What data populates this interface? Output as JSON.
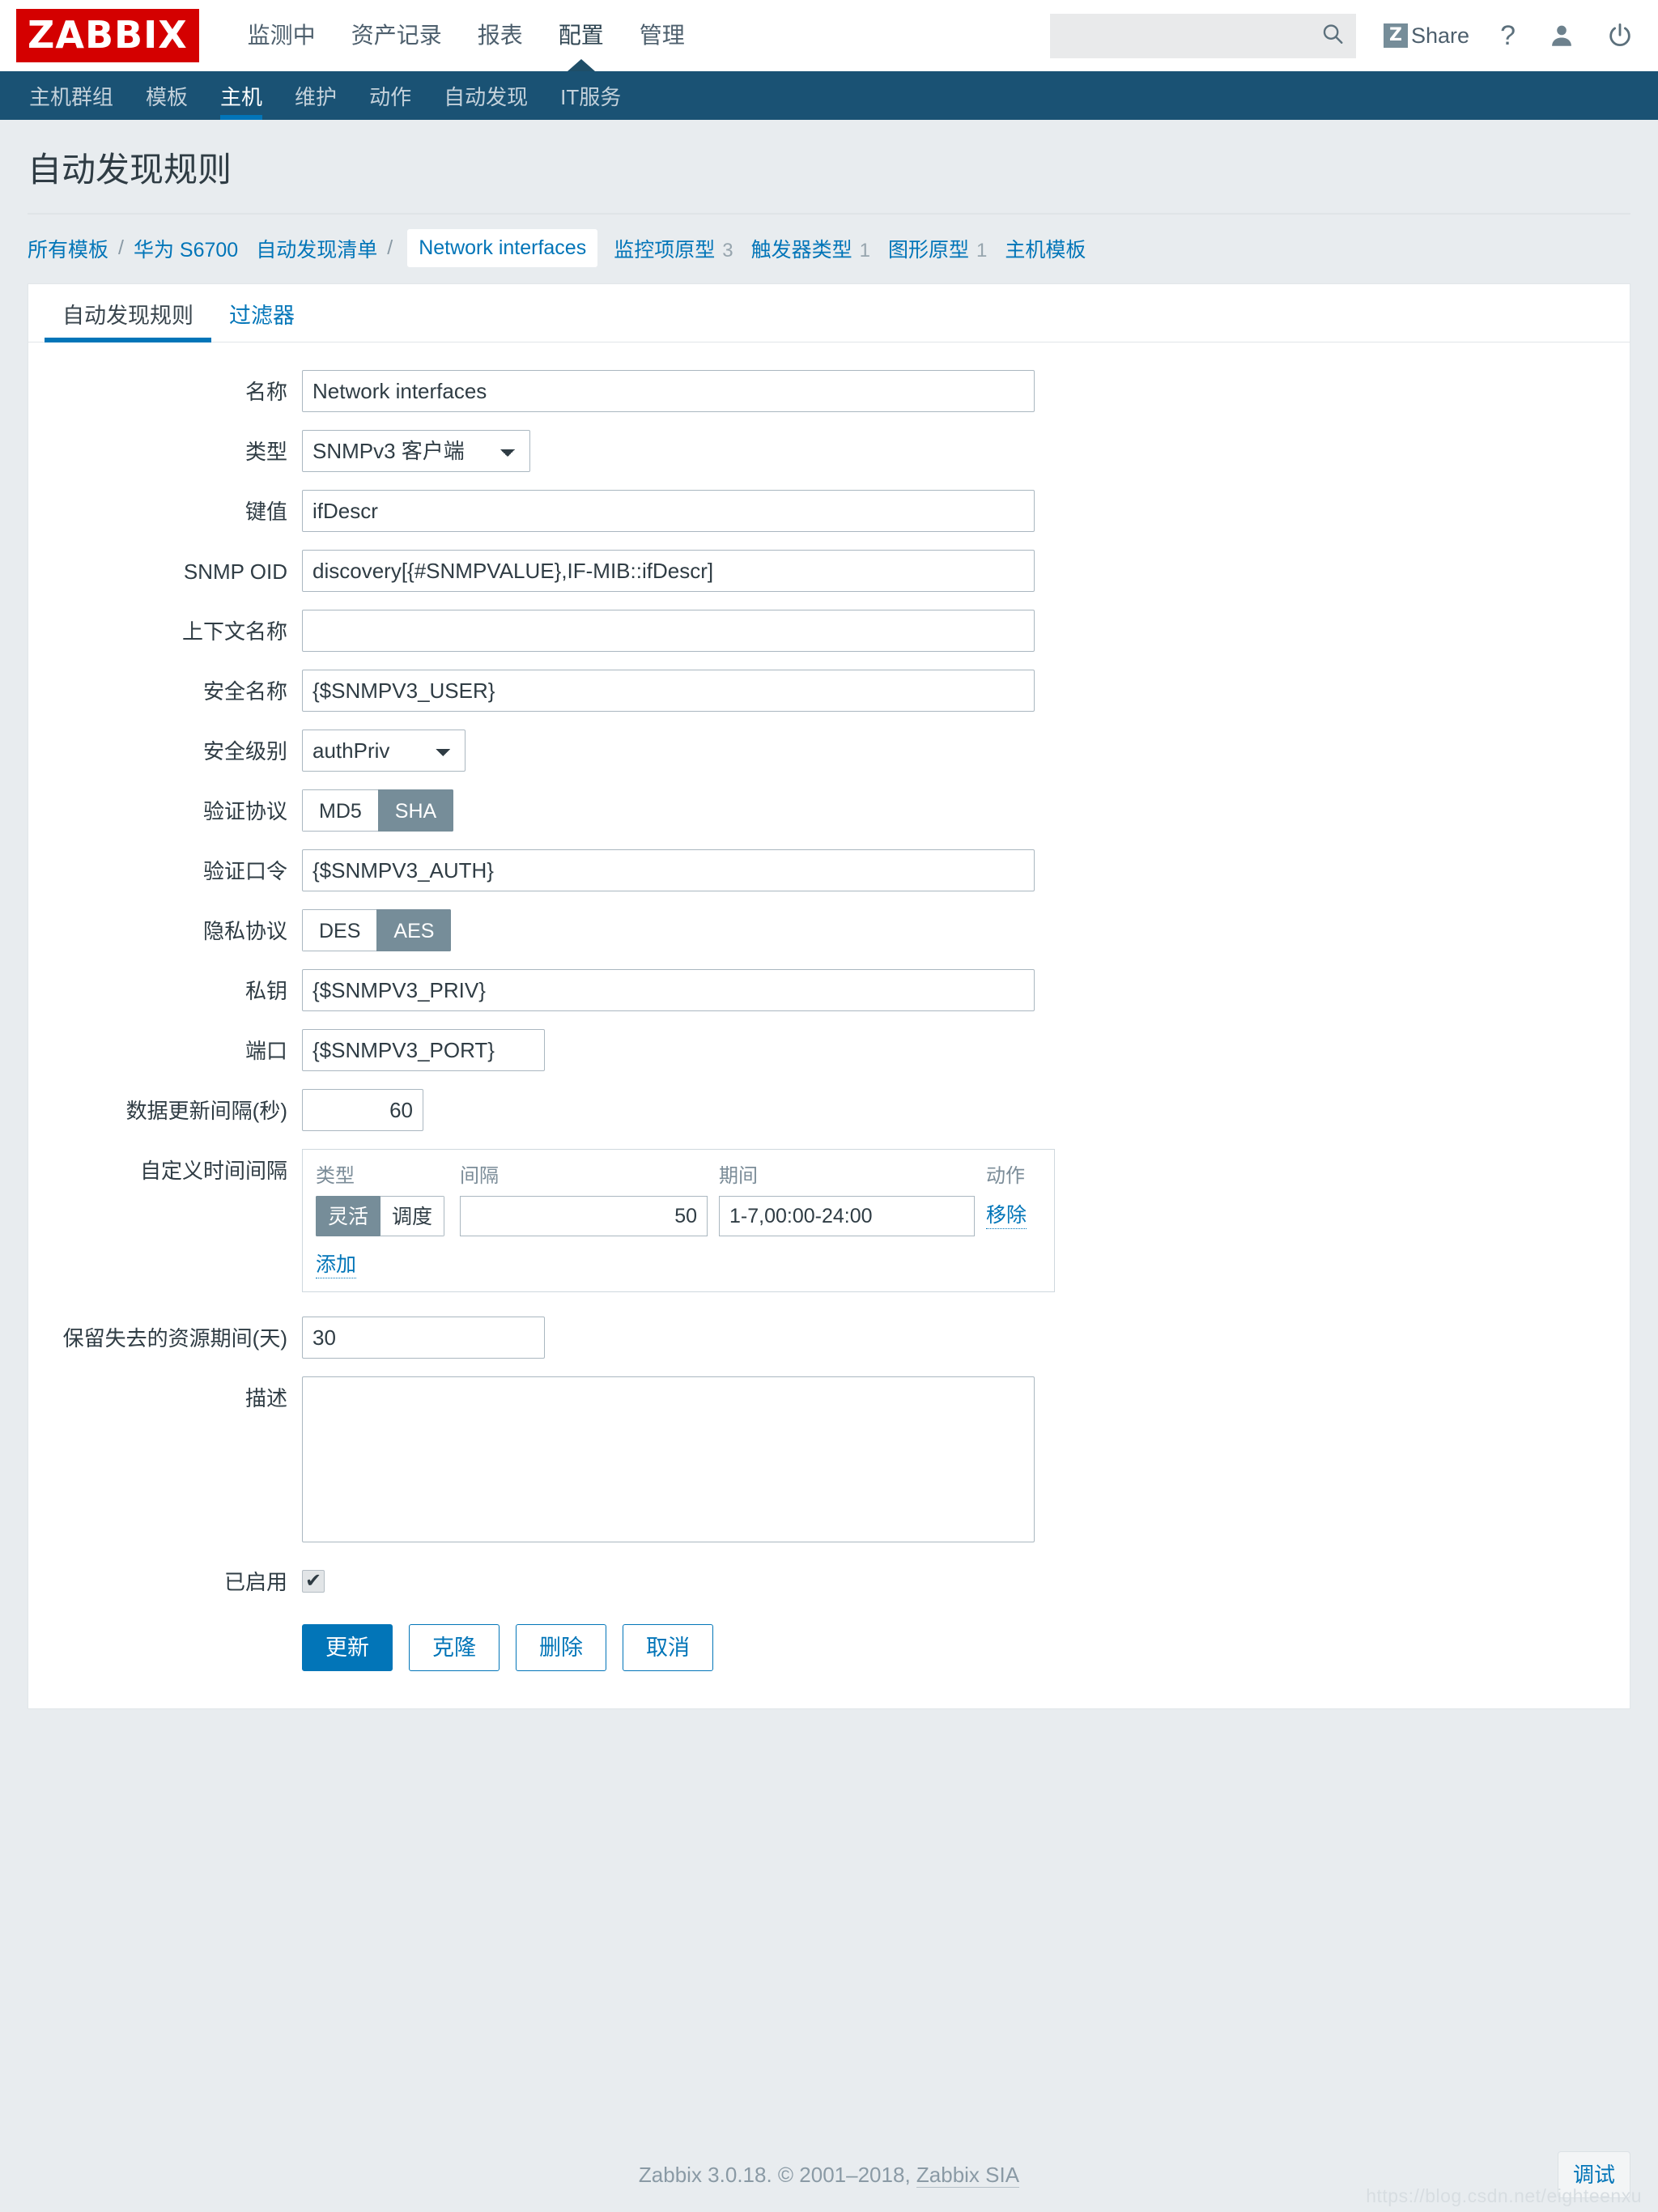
{
  "header": {
    "logo_text": "ZABBIX",
    "logo_color": "#d40000",
    "menu": [
      {
        "label": "监测中",
        "selected": false
      },
      {
        "label": "资产记录",
        "selected": false
      },
      {
        "label": "报表",
        "selected": false
      },
      {
        "label": "配置",
        "selected": true
      },
      {
        "label": "管理",
        "selected": false
      }
    ],
    "search": {
      "value": "",
      "placeholder": ""
    },
    "share_label": "Share",
    "share_badge": "Z",
    "help_label": "?",
    "icons": [
      "search-icon",
      "share-icon",
      "help-icon",
      "user-icon",
      "power-off-icon"
    ]
  },
  "subnav": {
    "items": [
      {
        "label": "主机群组",
        "selected": false
      },
      {
        "label": "模板",
        "selected": false
      },
      {
        "label": "主机",
        "selected": true
      },
      {
        "label": "维护",
        "selected": false
      },
      {
        "label": "动作",
        "selected": false
      },
      {
        "label": "自动发现",
        "selected": false
      },
      {
        "label": "IT服务",
        "selected": false
      }
    ],
    "bg_color": "#1a5274",
    "accent_color": "#0275b8"
  },
  "page_title": "自动发现规则",
  "breadcrumb": {
    "items": [
      {
        "label": "所有模板",
        "type": "link",
        "separator_after": true
      },
      {
        "label": "华为 S6700",
        "type": "link",
        "separator_after": false
      },
      {
        "label": "自动发现清单",
        "type": "link",
        "separator_after": true
      },
      {
        "label": "Network interfaces",
        "type": "current",
        "separator_after": false
      },
      {
        "label": "监控项原型",
        "type": "link",
        "count": "3",
        "separator_after": false
      },
      {
        "label": "触发器类型",
        "type": "link",
        "count": "1",
        "separator_after": false
      },
      {
        "label": "图形原型",
        "type": "link",
        "count": "1",
        "separator_after": false
      },
      {
        "label": "主机模板",
        "type": "link",
        "separator_after": false
      }
    ],
    "separator": "/"
  },
  "tabs": [
    {
      "label": "自动发现规则",
      "active": true
    },
    {
      "label": "过滤器",
      "active": false
    }
  ],
  "form": {
    "name": {
      "label": "名称",
      "value": "Network interfaces"
    },
    "type": {
      "label": "类型",
      "value": "SNMPv3 客户端"
    },
    "key": {
      "label": "键值",
      "value": "ifDescr"
    },
    "snmp_oid": {
      "label": "SNMP OID",
      "value": "discovery[{#SNMPVALUE},IF-MIB::ifDescr]"
    },
    "context_name": {
      "label": "上下文名称",
      "value": ""
    },
    "security_name": {
      "label": "安全名称",
      "value": "{$SNMPV3_USER}"
    },
    "security_level": {
      "label": "安全级别",
      "value": "authPriv"
    },
    "auth_protocol": {
      "label": "验证协议",
      "options": [
        "MD5",
        "SHA"
      ],
      "selected": "SHA"
    },
    "auth_passphrase": {
      "label": "验证口令",
      "value": "{$SNMPV3_AUTH}"
    },
    "priv_protocol": {
      "label": "隐私协议",
      "options": [
        "DES",
        "AES"
      ],
      "selected": "AES"
    },
    "priv_passphrase": {
      "label": "私钥",
      "value": "{$SNMPV3_PRIV}"
    },
    "port": {
      "label": "端口",
      "value": "{$SNMPV3_PORT}"
    },
    "update_interval": {
      "label": "数据更新间隔(秒)",
      "value": "60"
    },
    "custom_intervals": {
      "label": "自定义时间间隔",
      "columns": [
        "类型",
        "间隔",
        "期间",
        "动作"
      ],
      "rows": [
        {
          "type_options": [
            "灵活",
            "调度"
          ],
          "type_selected": "灵活",
          "interval": "50",
          "period": "1-7,00:00-24:00",
          "action_label": "移除"
        }
      ],
      "add_label": "添加"
    },
    "keep_lost": {
      "label": "保留失去的资源期间(天)",
      "value": "30"
    },
    "description": {
      "label": "描述",
      "value": ""
    },
    "enabled": {
      "label": "已启用",
      "checked": true,
      "mark": "✔"
    }
  },
  "buttons": [
    {
      "label": "更新",
      "style": "primary"
    },
    {
      "label": "克隆",
      "style": "default"
    },
    {
      "label": "删除",
      "style": "default"
    },
    {
      "label": "取消",
      "style": "default"
    }
  ],
  "footer": {
    "copyright_prefix": "Zabbix 3.0.18. © 2001–2018, ",
    "copyright_link": "Zabbix SIA",
    "debug_label": "调试",
    "watermark": "https://blog.csdn.net/eighteenxu"
  }
}
